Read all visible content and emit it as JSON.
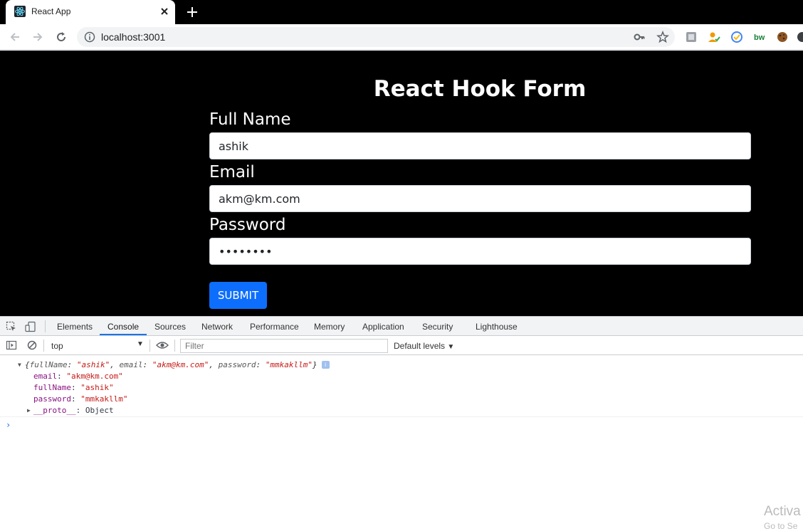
{
  "browser": {
    "tab_title": "React App",
    "url": "localhost:3001"
  },
  "form": {
    "title": "React Hook Form",
    "fields": [
      {
        "label": "Full Name",
        "value": "ashik"
      },
      {
        "label": "Email",
        "value": "akm@km.com"
      },
      {
        "label": "Password",
        "value": "mmkakllm"
      }
    ],
    "submit_label": "SUBMIT",
    "submit_color": "#0d6efd"
  },
  "devtools": {
    "tabs": [
      "Elements",
      "Console",
      "Sources",
      "Network",
      "Performance",
      "Memory",
      "Application",
      "Security",
      "Lighthouse"
    ],
    "active_tab": "Console",
    "context": "top",
    "filter_placeholder": "Filter",
    "levels_label": "Default levels",
    "log": {
      "summary_open": "{",
      "summary": [
        {
          "key": "fullName",
          "value": "\"ashik\""
        },
        {
          "key": "email",
          "value": "\"akm@km.com\""
        },
        {
          "key": "password",
          "value": "\"mmkakllm\""
        }
      ],
      "summary_close": "}",
      "info_badge": "i",
      "props": [
        {
          "key": "email",
          "value": "\"akm@km.com\""
        },
        {
          "key": "fullName",
          "value": "\"ashik\""
        },
        {
          "key": "password",
          "value": "\"mmkakllm\""
        }
      ],
      "proto_key": "__proto__",
      "proto_value": "Object"
    },
    "prompt_symbol": "›"
  },
  "watermark": {
    "line1": "Activa",
    "line2": "Go to Se"
  }
}
